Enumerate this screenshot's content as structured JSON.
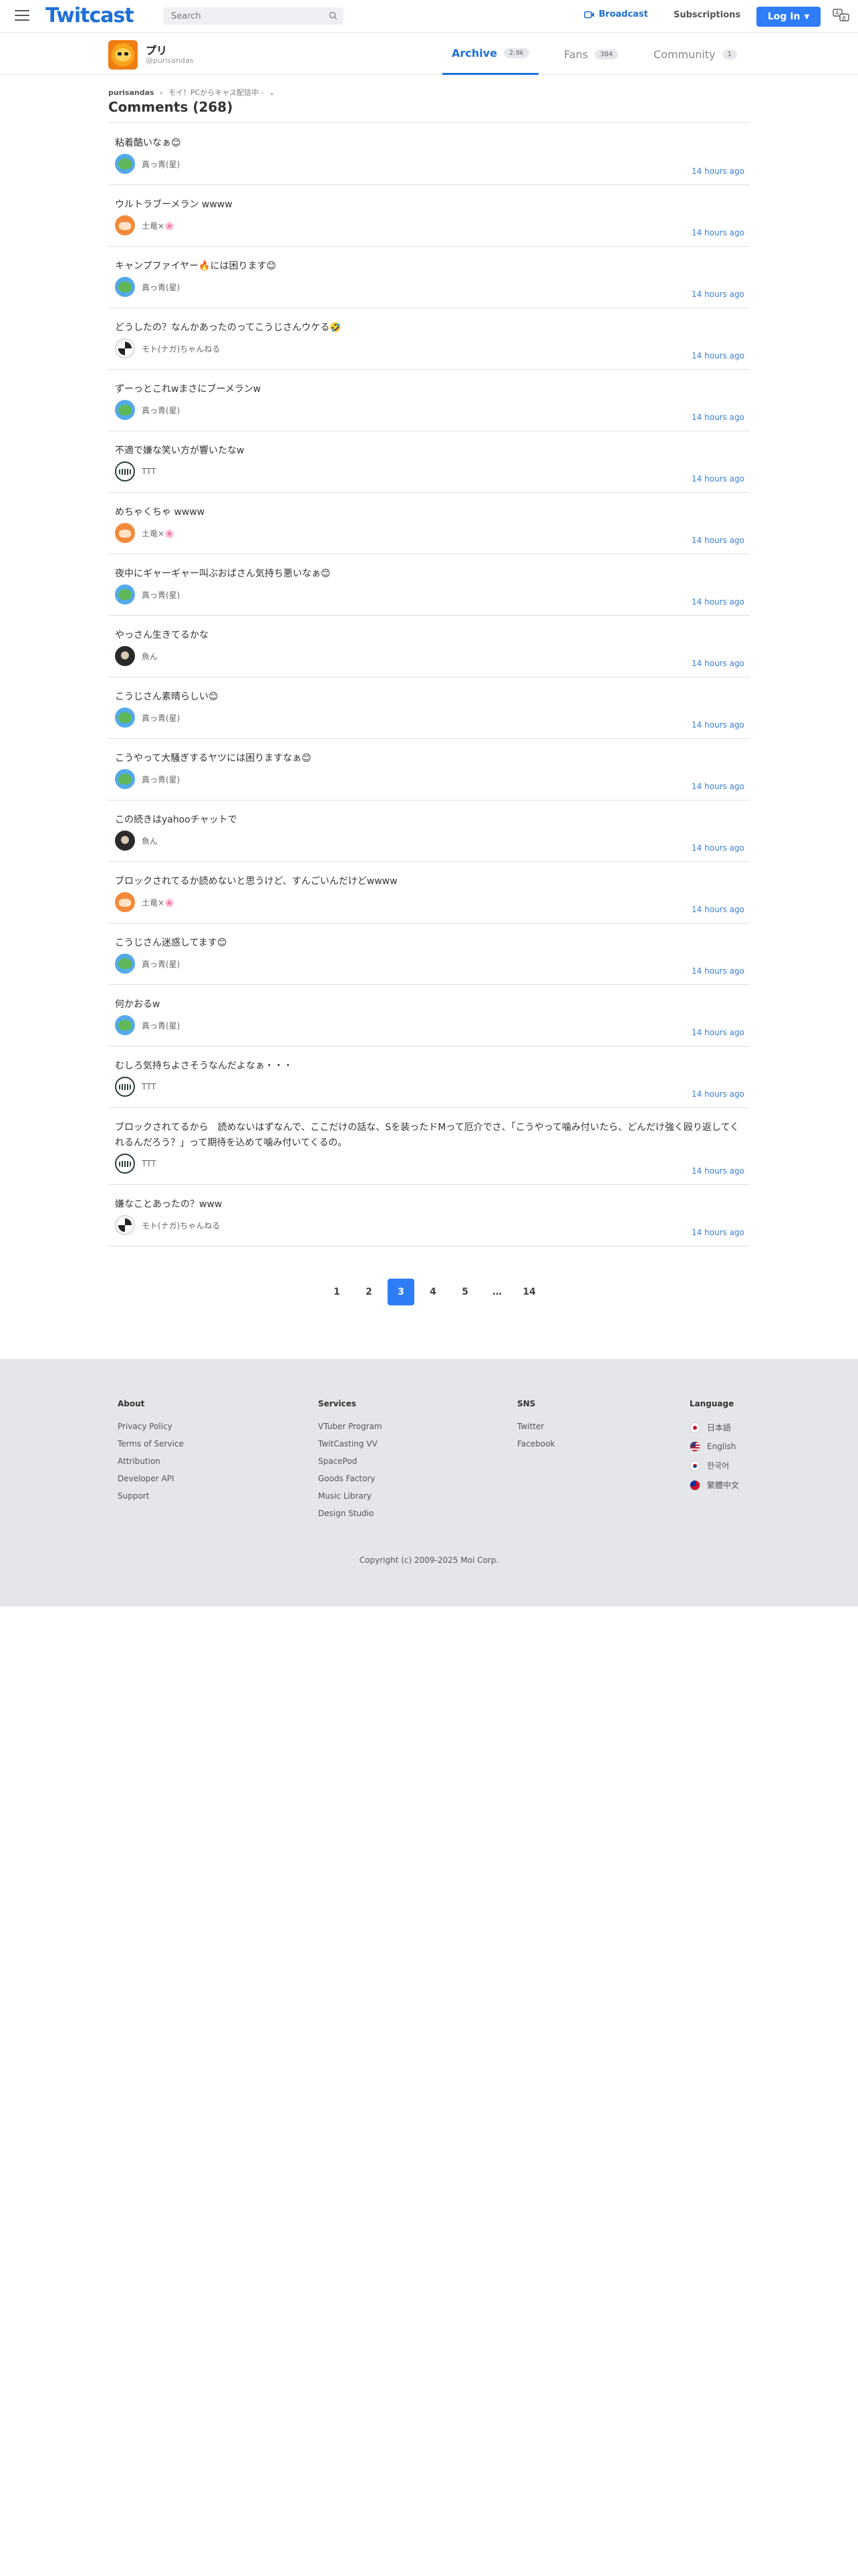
{
  "header": {
    "logo": "Twitcast",
    "search_placeholder": "Search",
    "broadcast_label": "Broadcast",
    "subscriptions_label": "Subscriptions",
    "login_label": "Log In"
  },
  "profile": {
    "name": "プリ",
    "handle": "@purisandas",
    "tabs": [
      {
        "label": "Archive",
        "count": "2.9k",
        "active": true
      },
      {
        "label": "Fans",
        "count": "384",
        "active": false
      },
      {
        "label": "Community",
        "count": "1",
        "active": false
      }
    ]
  },
  "breadcrumb": {
    "user": "purisandas",
    "separator": "›",
    "movie": "モイ！PCからキャス配信中 -",
    "chevron": "⌄"
  },
  "comments_title": "Comments (268)",
  "comments": [
    {
      "text": "粘着酷いなぁ😊",
      "user": "真っ青(星)",
      "time": "14 hours ago",
      "avatar": "green"
    },
    {
      "text": "ウルトラブーメラン wwww",
      "user": "土竜×🌸",
      "time": "14 hours ago",
      "avatar": "orange"
    },
    {
      "text": "キャンプファイヤー🔥には困ります😊",
      "user": "真っ青(星)",
      "time": "14 hours ago",
      "avatar": "green"
    },
    {
      "text": "どうしたの？なんかあったのってこうじさんウケる🤣",
      "user": "モト(ナガ)ちゃんねる",
      "time": "14 hours ago",
      "avatar": "bw"
    },
    {
      "text": "ずーっとこれwまさにブーメランw",
      "user": "真っ青(星)",
      "time": "14 hours ago",
      "avatar": "green"
    },
    {
      "text": "不適で嫌な笑い方が響いたなw",
      "user": "TTT",
      "time": "14 hours ago",
      "avatar": "ttt"
    },
    {
      "text": "めちゃくちゃ wwww",
      "user": "土竜×🌸",
      "time": "14 hours ago",
      "avatar": "orange"
    },
    {
      "text": "夜中にギャーギャー叫ぶおばさん気持ち悪いなぁ😊",
      "user": "真っ青(星)",
      "time": "14 hours ago",
      "avatar": "green"
    },
    {
      "text": "やっさん生きてるかな",
      "user": "魚ん",
      "time": "14 hours ago",
      "avatar": "dark"
    },
    {
      "text": "こうじさん素晴らしい😊",
      "user": "真っ青(星)",
      "time": "14 hours ago",
      "avatar": "green"
    },
    {
      "text": "こうやって大騒ぎするヤツには困りますなぁ😊",
      "user": "真っ青(星)",
      "time": "14 hours ago",
      "avatar": "green"
    },
    {
      "text": "この続きはyahooチャットで",
      "user": "魚ん",
      "time": "14 hours ago",
      "avatar": "dark"
    },
    {
      "text": "ブロックされてるか読めないと思うけど、すんごいんだけどwwww",
      "user": "土竜×🌸",
      "time": "14 hours ago",
      "avatar": "orange"
    },
    {
      "text": "こうじさん迷惑してます😊",
      "user": "真っ青(星)",
      "time": "14 hours ago",
      "avatar": "green"
    },
    {
      "text": "何かおるw",
      "user": "真っ青(星)",
      "time": "14 hours ago",
      "avatar": "green"
    },
    {
      "text": "むしろ気持ちよさそうなんだよなぁ・・・",
      "user": "TTT",
      "time": "14 hours ago",
      "avatar": "ttt"
    },
    {
      "text": "ブロックされてるから　読めないはずなんで、ここだけの話な、Sを装ったドMって厄介でさ、「こうやって噛み付いたら、どんだけ強く殴り返してくれるんだろう？」って期待を込めて噛み付いてくるの。",
      "user": "TTT",
      "time": "14 hours ago",
      "avatar": "ttt"
    },
    {
      "text": "嫌なことあったの？www",
      "user": "モト(ナガ)ちゃんねる",
      "time": "14 hours ago",
      "avatar": "bw"
    }
  ],
  "pagination": [
    "1",
    "2",
    "3",
    "4",
    "5",
    "…",
    "14"
  ],
  "current_page": "3",
  "footer": {
    "about": {
      "title": "About",
      "links": [
        "Privacy Policy",
        "Terms of Service",
        "Attribution",
        "Developer API",
        "Support"
      ]
    },
    "services": {
      "title": "Services",
      "links": [
        "VTuber Program",
        "TwitCasting VV",
        "SpacePod",
        "Goods Factory",
        "Music Library",
        "Design Studio"
      ]
    },
    "sns": {
      "title": "SNS",
      "links": [
        "Twitter",
        "Facebook"
      ]
    },
    "language": {
      "title": "Language",
      "links": [
        "日本語",
        "English",
        "한국어",
        "繁體中文"
      ]
    },
    "copyright": "Copyright (c) 2009-2025 Moi Corp."
  },
  "colors": {
    "accent": "#2e7df6",
    "brand": "#1e6fd9",
    "timestamp": "#3a7fd8"
  }
}
